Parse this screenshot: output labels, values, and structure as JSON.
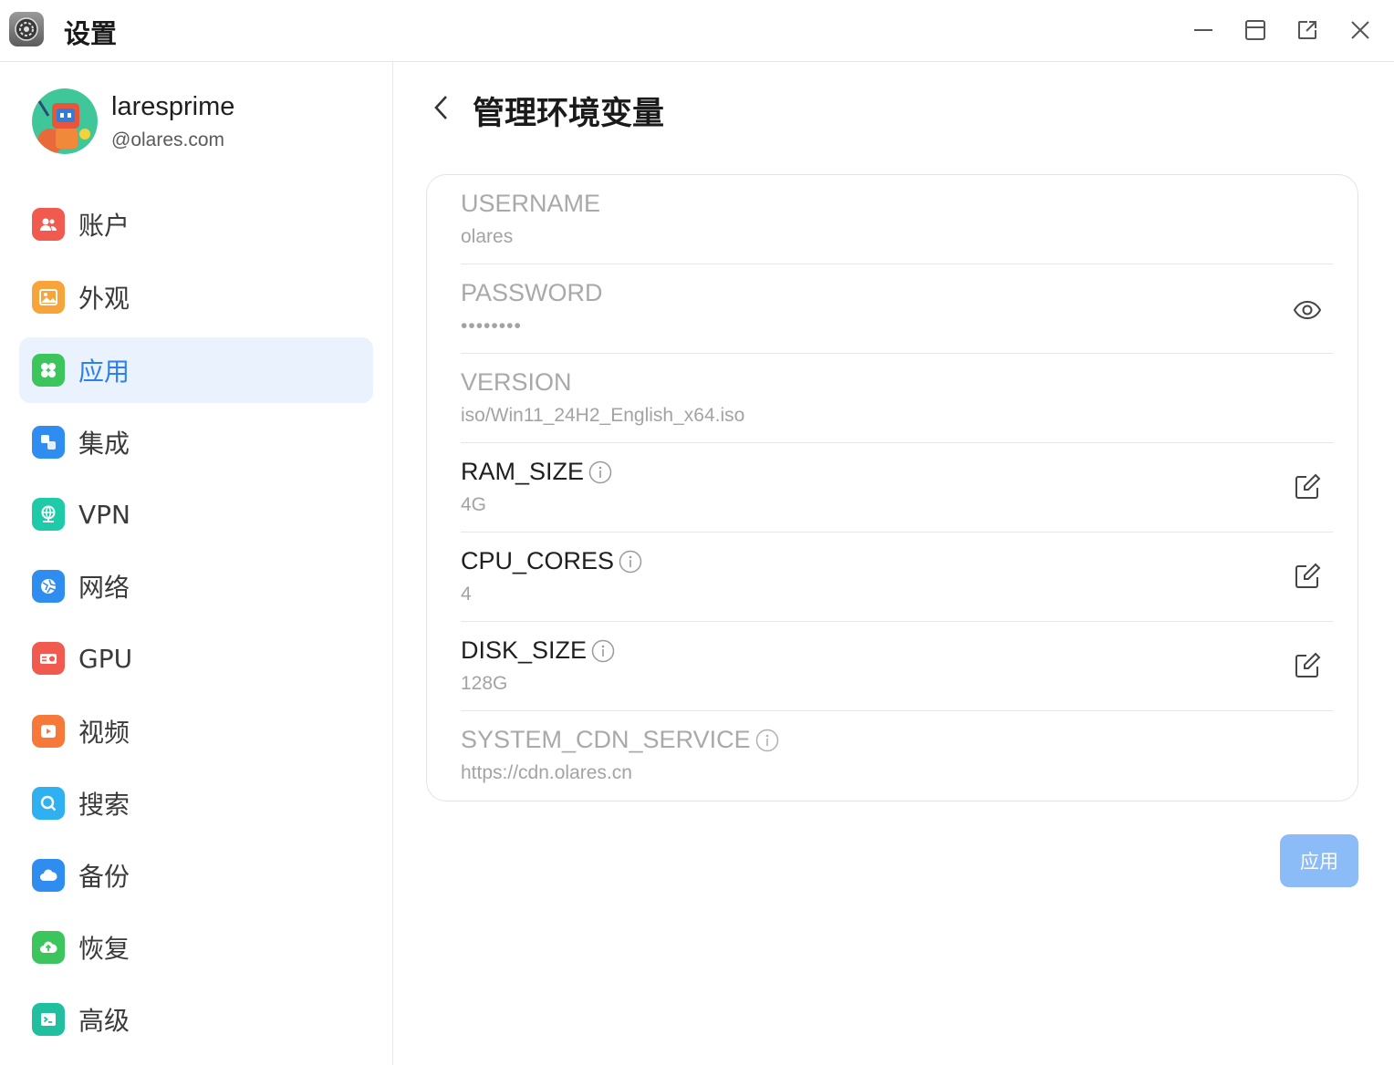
{
  "window": {
    "title": "设置",
    "controls": [
      "minimize-icon",
      "maximize-icon",
      "open-external-icon",
      "close-icon"
    ]
  },
  "user": {
    "name": "laresprime",
    "domain": "@olares.com"
  },
  "sidebar": {
    "items": [
      {
        "label": "账户",
        "icon": "account-icon",
        "color": "#f05a4f"
      },
      {
        "label": "外观",
        "icon": "appearance-icon",
        "color": "#f7a43a"
      },
      {
        "label": "应用",
        "icon": "apps-icon",
        "color": "#3bc55c",
        "active": true
      },
      {
        "label": "集成",
        "icon": "integration-icon",
        "color": "#2f8df0"
      },
      {
        "label": "VPN",
        "icon": "vpn-icon",
        "color": "#1fcaa8"
      },
      {
        "label": "网络",
        "icon": "network-icon",
        "color": "#2f8df0"
      },
      {
        "label": "GPU",
        "icon": "gpu-icon",
        "color": "#f05a4f"
      },
      {
        "label": "视频",
        "icon": "video-icon",
        "color": "#f7793a"
      },
      {
        "label": "搜索",
        "icon": "search-icon",
        "color": "#2fb0f0"
      },
      {
        "label": "备份",
        "icon": "backup-icon",
        "color": "#2f8df0"
      },
      {
        "label": "恢复",
        "icon": "restore-icon",
        "color": "#3bc55c"
      },
      {
        "label": "高级",
        "icon": "terminal-icon",
        "color": "#1fbfa0"
      }
    ]
  },
  "main": {
    "title": "管理环境变量",
    "env_vars": [
      {
        "key": "USERNAME",
        "value": "olares",
        "editable": false,
        "info": false,
        "action": null
      },
      {
        "key": "PASSWORD",
        "value": "••••••••",
        "editable": false,
        "info": false,
        "action": "eye-icon"
      },
      {
        "key": "VERSION",
        "value": "iso/Win11_24H2_English_x64.iso",
        "editable": false,
        "info": false,
        "action": null
      },
      {
        "key": "RAM_SIZE",
        "value": "4G",
        "editable": true,
        "info": true,
        "action": "edit-icon"
      },
      {
        "key": "CPU_CORES",
        "value": "4",
        "editable": true,
        "info": true,
        "action": "edit-icon"
      },
      {
        "key": "DISK_SIZE",
        "value": "128G",
        "editable": true,
        "info": true,
        "action": "edit-icon"
      },
      {
        "key": "SYSTEM_CDN_SERVICE",
        "value": "https://cdn.olares.cn",
        "editable": false,
        "info": true,
        "action": null
      }
    ],
    "apply_label": "应用"
  },
  "colors": {
    "accent": "#2f7fe8",
    "active_bg": "#e9f2fd",
    "apply_button": "#8cbcf7"
  }
}
